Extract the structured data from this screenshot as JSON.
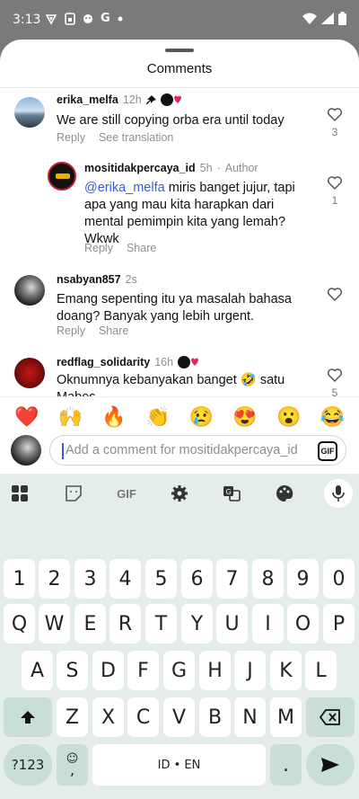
{
  "status": {
    "time": "3:13",
    "notif_icons": [
      "vpn-icon",
      "sim-icon",
      "app-icon",
      "google-icon",
      "dot-icon"
    ]
  },
  "sheet": {
    "title": "Comments"
  },
  "comments": [
    {
      "username": "erika_melfa",
      "time": "12h",
      "text": "We are still copying orba era until today",
      "reply": "Reply",
      "see_translation": "See translation",
      "likes": "3"
    },
    {
      "username": "mositidakpercaya_id",
      "time": "5h",
      "author": "Author",
      "mention": "@erika_melfa",
      "text": " miris banget jujur, tapi apa yang mau kita harapkan dari mental pemimpin kita yang lemah? Wkwk",
      "reply": "Reply",
      "share": "Share",
      "likes": "1"
    },
    {
      "username": "nsabyan857",
      "time": "2s",
      "text": "Emang sepenting itu ya masalah bahasa doang? Banyak yang lebih urgent.",
      "reply": "Reply",
      "share": "Share"
    },
    {
      "username": "redflag_solidarity",
      "time": "16h",
      "text": "Oknumnya kebanyakan banget 🤣 satu Mabes",
      "likes": "5"
    }
  ],
  "emojis": [
    "❤️",
    "🙌",
    "🔥",
    "👏",
    "😢",
    "😍",
    "😮",
    "😂"
  ],
  "composer": {
    "placeholder": "Add a comment for mositidakpercaya_id",
    "gif": "GIF"
  },
  "keyboard": {
    "toolbar_gif": "GIF",
    "row_numbers": [
      "1",
      "2",
      "3",
      "4",
      "5",
      "6",
      "7",
      "8",
      "9",
      "0"
    ],
    "row1": [
      "Q",
      "W",
      "E",
      "R",
      "T",
      "Y",
      "U",
      "I",
      "O",
      "P"
    ],
    "row2": [
      "A",
      "S",
      "D",
      "F",
      "G",
      "H",
      "J",
      "K",
      "L"
    ],
    "row3": [
      "Z",
      "X",
      "C",
      "V",
      "B",
      "N",
      "M"
    ],
    "symbols_key": "?123",
    "comma_key": ",",
    "space_label": "ID • EN",
    "period_key": "."
  }
}
